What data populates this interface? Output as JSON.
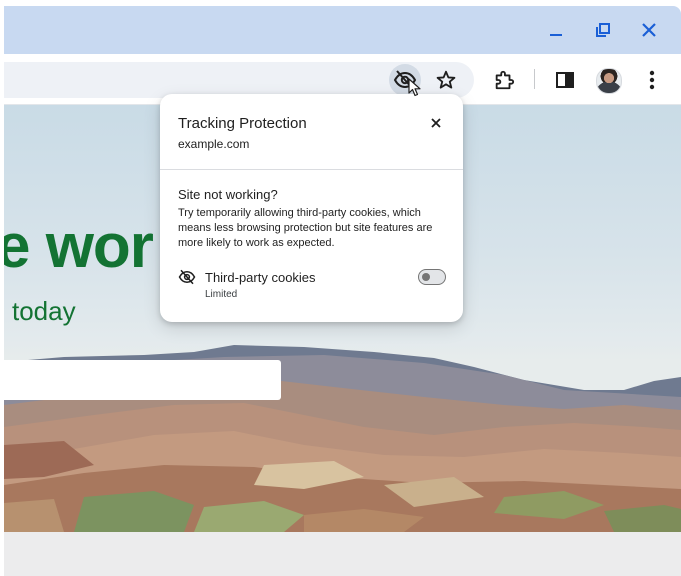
{
  "window": {
    "controls": [
      "minimize-icon",
      "restore-icon",
      "close-icon"
    ],
    "titlebar_color": "#c8d9f1"
  },
  "toolbar": {
    "icons": [
      "eye-slash-icon",
      "star-icon",
      "extensions-icon",
      "side-panel-icon",
      "avatar",
      "more-vert-icon"
    ],
    "tracking_icon_active": true
  },
  "page": {
    "hero_title": "e wor",
    "hero_subtitle": "today",
    "accent_color": "#137333"
  },
  "popup": {
    "title": "Tracking Protection",
    "site": "example.com",
    "section_title": "Site not working?",
    "description": "Try temporarily allowing third-party cookies, which means less browsing protection but site features are more likely to work as expected.",
    "cookies_label": "Third-party cookies",
    "cookies_status": "Limited",
    "cookies_toggle_on": false
  }
}
